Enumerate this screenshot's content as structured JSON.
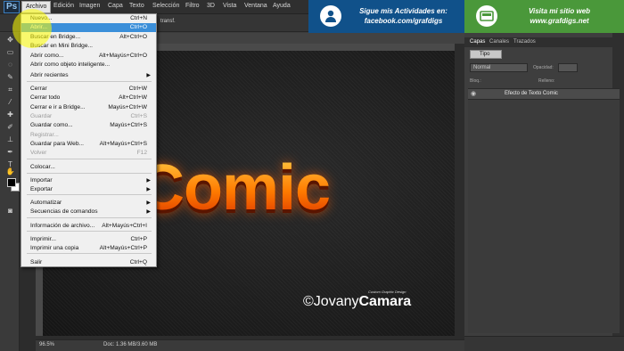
{
  "app": {
    "logo": "Ps"
  },
  "menubar": {
    "items": [
      "Archivo",
      "Edición",
      "Imagen",
      "Capa",
      "Texto",
      "Selección",
      "Filtro",
      "3D",
      "Vista",
      "Ventana",
      "Ayuda"
    ]
  },
  "optionsbar": {
    "transf_label": "transf."
  },
  "banner_facebook": {
    "line1": "Sigue mis Actividades en:",
    "line2": "facebook.com/grafdigs",
    "color": "#10518a",
    "icon": "facebook-user-icon"
  },
  "banner_web": {
    "line1": "Visita mi sitio web",
    "line2": "www.grafdigs.net",
    "color": "#4a983a",
    "icon": "website-icon"
  },
  "archivo_menu": {
    "items": [
      {
        "label": "Nuevo...",
        "shortcut": "Ctrl+N"
      },
      {
        "label": "Abrir...",
        "shortcut": "Ctrl+O",
        "highlighted": true
      },
      {
        "label": "Buscar en Bridge...",
        "shortcut": "Alt+Ctrl+O"
      },
      {
        "label": "Buscar en Mini Bridge...",
        "shortcut": ""
      },
      {
        "label": "Abrir como...",
        "shortcut": "Alt+Mayús+Ctrl+O"
      },
      {
        "label": "Abrir como objeto inteligente...",
        "shortcut": ""
      },
      {
        "label": "Abrir recientes",
        "submenu": true
      },
      {
        "label": "Cerrar",
        "shortcut": "Ctrl+W"
      },
      {
        "label": "Cerrar todo",
        "shortcut": "Alt+Ctrl+W"
      },
      {
        "label": "Cerrar e ir a Bridge...",
        "shortcut": "Mayús+Ctrl+W"
      },
      {
        "label": "Guardar",
        "shortcut": "Ctrl+S",
        "disabled": true
      },
      {
        "label": "Guardar como...",
        "shortcut": "Mayús+Ctrl+S"
      },
      {
        "label": "Registrar...",
        "shortcut": "",
        "disabled": true
      },
      {
        "label": "Guardar para Web...",
        "shortcut": "Alt+Mayús+Ctrl+S"
      },
      {
        "label": "Volver",
        "shortcut": "F12",
        "disabled": true
      },
      {
        "label": "Colocar...",
        "shortcut": ""
      },
      {
        "label": "Importar",
        "submenu": true
      },
      {
        "label": "Exportar",
        "submenu": true
      },
      {
        "label": "Automatizar",
        "submenu": true
      },
      {
        "label": "Secuencias de comandos",
        "submenu": true
      },
      {
        "label": "Información de archivo...",
        "shortcut": "Alt+Mayús+Ctrl+I"
      },
      {
        "label": "Imprimir...",
        "shortcut": "Ctrl+P"
      },
      {
        "label": "Imprimir una copia",
        "shortcut": "Alt+Mayús+Ctrl+P"
      },
      {
        "label": "Salir",
        "shortcut": "Ctrl+Q"
      }
    ]
  },
  "canvas": {
    "artwork_text": "Comic",
    "signature_name_light": "Jovany",
    "signature_name_bold": "Camara",
    "signature_sub": "Custom Graphic Design",
    "signature_mark": "©"
  },
  "status": {
    "zoom": "96.5%",
    "doc": "Doc: 1.36 MB/3.60 MB"
  },
  "layers_panel": {
    "tabs": [
      "Capas",
      "Canales",
      "Trazados"
    ],
    "filter": "Tipo",
    "blend_mode": "Normal",
    "opacity_label": "Opacidad:",
    "lock_label": "Bloq.:",
    "fill_label": "Relleno:",
    "layer_name": "Efecto de Texto Comic"
  }
}
